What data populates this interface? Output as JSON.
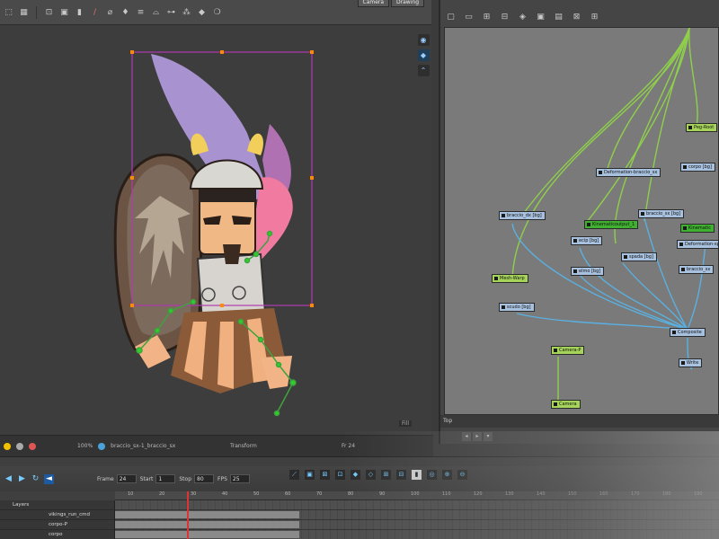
{
  "top_toolbar": {
    "view_tabs": [
      "Camera",
      "Drawing"
    ]
  },
  "viewport": {
    "corner_label": "Fill"
  },
  "status_bar": {
    "zoom": "100%",
    "selection": "braccio_sx-1_braccio_sx",
    "tool": "Transform",
    "frame": "Fr 24"
  },
  "node_view": {
    "bottom_label": "Top",
    "nodes": [
      {
        "label": "Peg-Root",
        "color": "green"
      },
      {
        "label": "Deformation-braccio_sx",
        "color": "blue"
      },
      {
        "label": "corpo [bg]",
        "color": "blue"
      },
      {
        "label": "braccio_dx [bg]",
        "color": "blue"
      },
      {
        "label": "Kinematicoutput_1",
        "color": "dkgreen"
      },
      {
        "label": "braccio_sx [bg]",
        "color": "blue"
      },
      {
        "label": "Kinematic",
        "color": "dkgreen"
      },
      {
        "label": "Deformation-spada",
        "color": "blue"
      },
      {
        "label": "ecip [bg]",
        "color": "blue"
      },
      {
        "label": "spada [bg]",
        "color": "blue"
      },
      {
        "label": "elmo [bg]",
        "color": "blue"
      },
      {
        "label": "Mesh-Warp",
        "color": "green"
      },
      {
        "label": "scudo [bg]",
        "color": "blue"
      },
      {
        "label": "Composite",
        "color": "blue"
      },
      {
        "label": "Camera-P",
        "color": "green"
      },
      {
        "label": "Camera",
        "color": "green"
      },
      {
        "label": "Write",
        "color": "blue"
      },
      {
        "label": "braccio_sx",
        "color": "blue"
      }
    ]
  },
  "timeline": {
    "frame_label": "Frame",
    "frame_value": "24",
    "start_label": "Start",
    "start_value": "1",
    "stop_label": "Stop",
    "stop_value": "80",
    "fps_label": "FPS",
    "fps_value": "25",
    "ruler_ticks": [
      "10",
      "20",
      "30",
      "40",
      "50",
      "60",
      "70",
      "80",
      "90",
      "100",
      "110",
      "120",
      "130",
      "140",
      "150",
      "160",
      "170",
      "180",
      "190"
    ],
    "layers": [
      {
        "name": "Layers"
      },
      {
        "name": "vikings_run_cmd"
      },
      {
        "name": "corpo-P"
      },
      {
        "name": "corpo"
      }
    ]
  },
  "colors": {
    "selection_box": "#b03ab0",
    "node_blue": "#a7c1de",
    "node_green": "#a6d45a",
    "wire_green": "#8fd04a",
    "wire_blue": "#5ab0e0",
    "playhead": "#dd3333"
  },
  "icons": {
    "viewport_side": [
      "contour-icon",
      "perspective-icon",
      "reset-view-icon"
    ],
    "top_tools": [
      "select-icon",
      "grid-icon",
      "transform-icon",
      "lock-icon",
      "brush-icon",
      "pencil-icon",
      "eraser-icon",
      "paint-icon",
      "bone-icon",
      "deform-icon",
      "kinematic-icon",
      "cutter-icon",
      "morph-icon",
      "dropper-icon"
    ]
  }
}
